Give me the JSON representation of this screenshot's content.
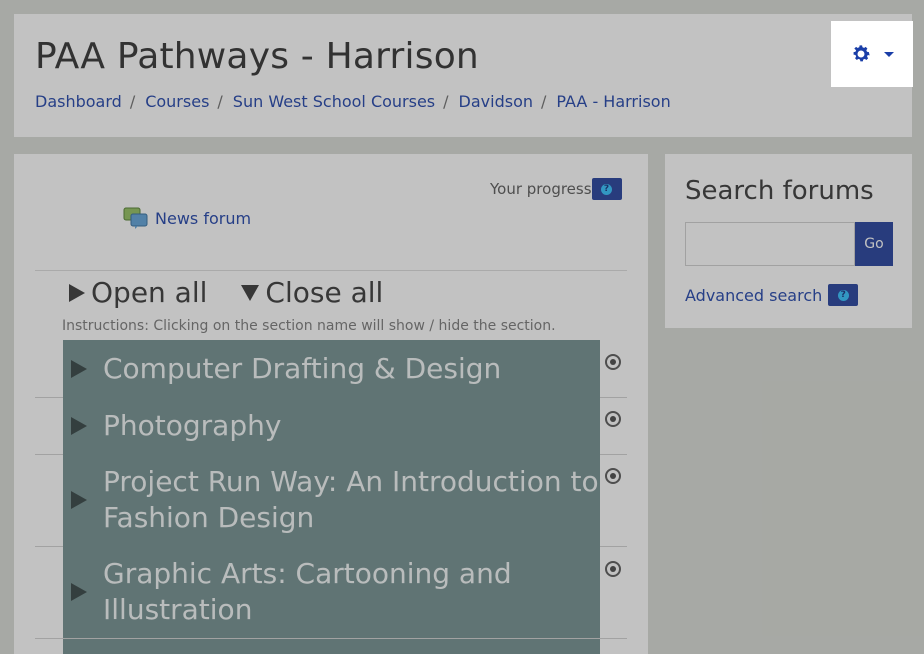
{
  "header": {
    "title": "PAA Pathways - Harrison",
    "breadcrumb": [
      "Dashboard",
      "Courses",
      "Sun West School Courses",
      "Davidson",
      "PAA - Harrison"
    ],
    "breadcrumb_separator": "/"
  },
  "course": {
    "progress_label": "Your progress",
    "help_glyph": "?",
    "news_forum_label": "News forum",
    "open_all_label": "Open all",
    "close_all_label": "Close all",
    "instructions": "Instructions: Clicking on the section name will show / hide the section.",
    "sections": [
      {
        "title": "Computer Drafting & Design"
      },
      {
        "title": "Photography"
      },
      {
        "title": "Project Run Way: An Introduction to Fashion Design"
      },
      {
        "title": "Graphic Arts: Cartooning and Illustration"
      }
    ]
  },
  "search_forums": {
    "title": "Search forums",
    "input_value": "",
    "go_label": "Go",
    "advanced_label": "Advanced search",
    "help_glyph": "?"
  },
  "icons": {
    "gear": "gear-icon",
    "caret": "chevron-down-icon",
    "forum": "forum-icon",
    "help": "help-icon"
  },
  "colors": {
    "link": "#1a3ea8",
    "button": "#1d3a9a",
    "section_bg": "#6f8d8d"
  }
}
